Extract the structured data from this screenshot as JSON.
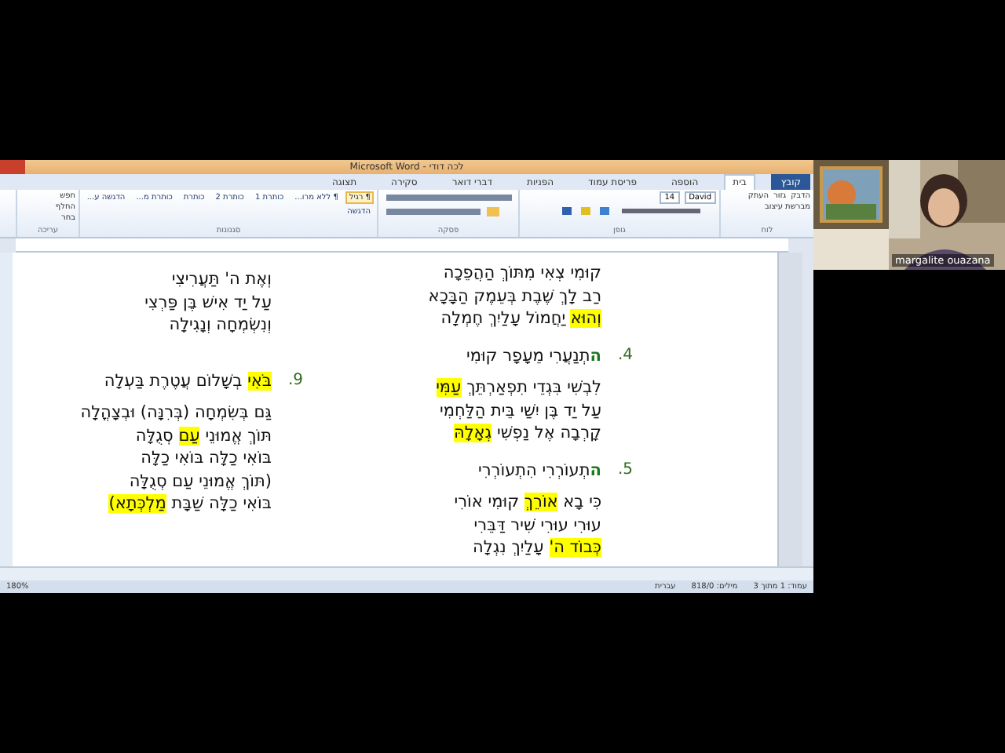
{
  "window": {
    "title": "Microsoft Word - לכה דודי"
  },
  "ribbon": {
    "tabs": [
      {
        "label": "קובץ",
        "selected": false,
        "kind": "file"
      },
      {
        "label": "בית",
        "selected": true,
        "kind": "tab"
      },
      {
        "label": "הוספה",
        "selected": false,
        "kind": "tab"
      },
      {
        "label": "פריסת עמוד",
        "selected": false,
        "kind": "tab"
      },
      {
        "label": "הפניות",
        "selected": false,
        "kind": "tab"
      },
      {
        "label": "דברי דואר",
        "selected": false,
        "kind": "tab"
      },
      {
        "label": "סקירה",
        "selected": false,
        "kind": "tab"
      },
      {
        "label": "תצוגה",
        "selected": false,
        "kind": "tab"
      }
    ],
    "groups": [
      {
        "label": "לוח",
        "kind": "clipboard",
        "items": [
          "הדבק",
          "גזור",
          "העתק",
          "מברשת עיצוב"
        ]
      },
      {
        "label": "גופן",
        "kind": "font",
        "items": [
          "David",
          "14"
        ]
      },
      {
        "label": "פסקה",
        "kind": "paragraph"
      },
      {
        "label": "סגנונות",
        "kind": "styles",
        "items": [
          "¶ רגיל",
          "¶ ללא מרו...",
          "כותרת 1",
          "כותרת 2",
          "כותרת",
          "כותרת מ...",
          "הדגשה ע...",
          "הדגשה"
        ]
      },
      {
        "label": "עריכה",
        "kind": "editing",
        "items": [
          "חפש",
          "החלף",
          "בחר"
        ]
      }
    ]
  },
  "document": {
    "columns": [
      {
        "stanzas": [
          {
            "lines": [
              [
                {
                  "text": "קוּמִי צְאִי מִתּוֹךְ הַהֲפֵכָה",
                  "highlighted": false,
                  "accent": false
                }
              ],
              [
                {
                  "text": "רַב לָךְ שֶׁבֶת בְּעֵמֶק הַבָּכָא",
                  "highlighted": false,
                  "accent": false
                }
              ],
              [
                {
                  "text": "וְהוּא",
                  "highlighted": true,
                  "accent": false
                },
                {
                  "text": " יַחֲמוֹל עָלַיִךְ חֶמְלָה",
                  "highlighted": false,
                  "accent": false
                }
              ]
            ]
          },
          {
            "number": "4.",
            "heading": [
              {
                "text": "ה",
                "highlighted": false,
                "accent": true
              },
              {
                "text": "תְנַעֲרִי מֵעָפָר קוּמִי",
                "highlighted": false,
                "accent": false
              }
            ],
            "lines": [
              [
                {
                  "text": "לִבְשִׁי בִּגְדֵי תִפְאַרְתֵּךְ ",
                  "highlighted": false,
                  "accent": false
                },
                {
                  "text": "עַמִּי",
                  "highlighted": true,
                  "accent": false
                }
              ],
              [
                {
                  "text": "עַל יַד בֶּן יִשַׁי בֵּית הַלַּחְמִי",
                  "highlighted": false,
                  "accent": false
                }
              ],
              [
                {
                  "text": "קָרְבָה אֶל נַפְשִׁי ",
                  "highlighted": false,
                  "accent": false
                },
                {
                  "text": "גְאָלָהּ",
                  "highlighted": true,
                  "accent": false
                }
              ]
            ]
          },
          {
            "number": "5.",
            "heading": [
              {
                "text": "ה",
                "highlighted": false,
                "accent": true
              },
              {
                "text": "תְעוֹרְרִי הִתְעוֹרְרִי",
                "highlighted": false,
                "accent": false
              }
            ],
            "lines": [
              [
                {
                  "text": "כִּי בָא ",
                  "highlighted": false,
                  "accent": false
                },
                {
                  "text": "אוֹרֵךְ",
                  "highlighted": true,
                  "accent": false
                },
                {
                  "text": " קוּמִי אוֹרִי",
                  "highlighted": false,
                  "accent": false
                }
              ],
              [
                {
                  "text": "עוּרִי עוּרִי שִׁיר דַּבֵּרִי",
                  "highlighted": false,
                  "accent": false
                }
              ],
              [
                {
                  "text": "כְּבוֹד ה'",
                  "highlighted": true,
                  "accent": false
                },
                {
                  "text": " עָלַיִךְ נִגְלָה",
                  "highlighted": false,
                  "accent": false
                }
              ]
            ]
          }
        ]
      },
      {
        "stanzas": [
          {
            "lines": [
              [
                {
                  "text": "וְאֶת ה' תַּעֲרִיצִי",
                  "highlighted": false,
                  "accent": false
                }
              ],
              [
                {
                  "text": "עַל יַד אִישׁ בֶּן פַּרְצִי",
                  "highlighted": false,
                  "accent": false
                }
              ],
              [
                {
                  "text": "וְנִשְׂמְחָה וְנָגִילָה",
                  "highlighted": false,
                  "accent": false
                }
              ]
            ]
          },
          {
            "number": "9.",
            "heading": [
              {
                "text": "בֹּאִי",
                "highlighted": true,
                "accent": false
              },
              {
                "text": " בְשָׁלוֹם עֲטֶרֶת בַּעְלָה",
                "highlighted": false,
                "accent": false
              }
            ],
            "lines": [
              [
                {
                  "text": "גַּם בְּשִׂמְחָה (בְּרִנָּה) וּבְצָהֳלָה",
                  "highlighted": false,
                  "accent": false
                }
              ],
              [
                {
                  "text": "תּוֹךְ אֱמוּנֵי ",
                  "highlighted": false,
                  "accent": false
                },
                {
                  "text": "עַם",
                  "highlighted": true,
                  "accent": false
                },
                {
                  "text": " סְגֻלָּה",
                  "highlighted": false,
                  "accent": false
                }
              ],
              [
                {
                  "text": "בּוֹאִי כַלָּה בּוֹאִי כַלָּה",
                  "highlighted": false,
                  "accent": false
                }
              ],
              [
                {
                  "text": "(תּוֹךְ אֱמוּנֵי עַם סְגֻלָּה",
                  "highlighted": false,
                  "accent": false
                }
              ],
              [
                {
                  "text": "בּוֹאִי כַלָּה שַׁבָּת ",
                  "highlighted": false,
                  "accent": false
                },
                {
                  "text": "מַלְכְּתָא)",
                  "highlighted": true,
                  "accent": false
                }
              ]
            ]
          }
        ]
      }
    ]
  },
  "status_bar": {
    "items": [
      "עמוד: 1 מתוך 3",
      "מילים: 818/0",
      "עברית"
    ],
    "zoom": "180%"
  },
  "participants": [
    {
      "kind": "painting"
    },
    {
      "kind": "person",
      "name": "margalite ouazana"
    }
  ]
}
